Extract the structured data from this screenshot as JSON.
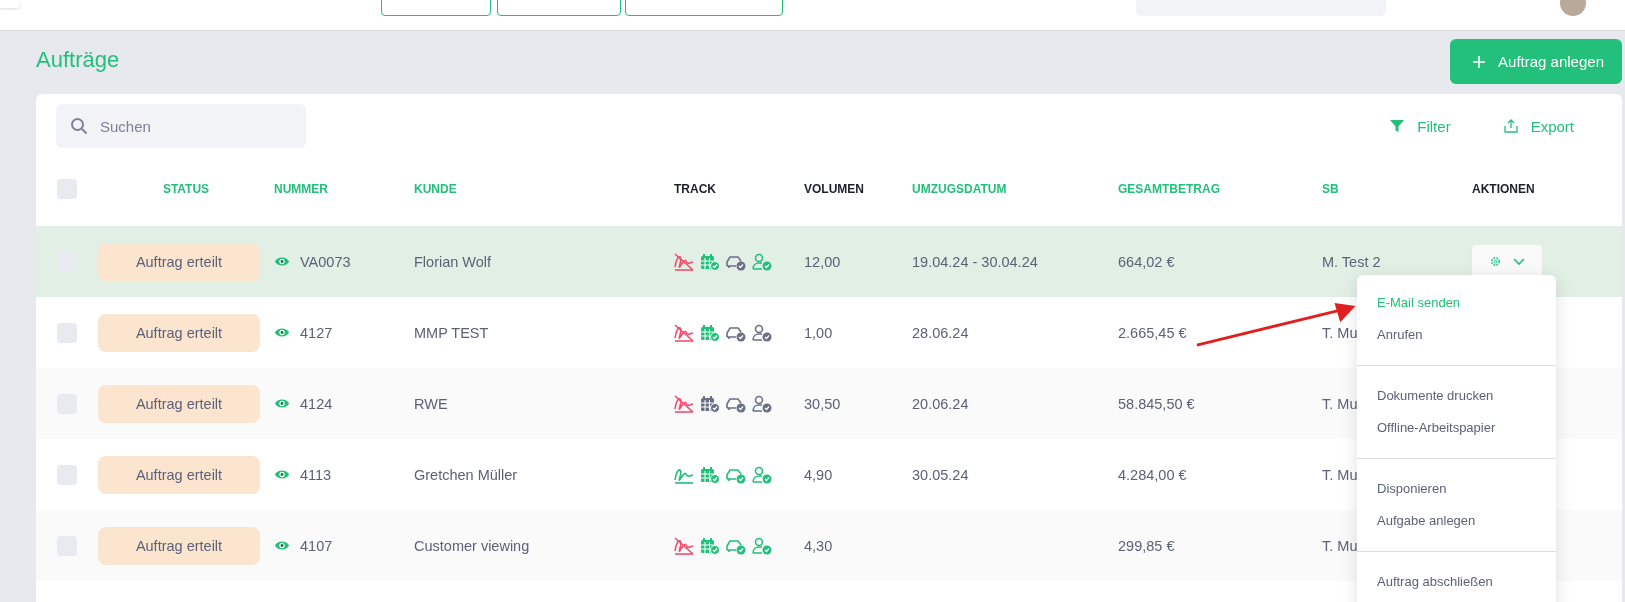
{
  "page_title": "Aufträge",
  "create_button": {
    "label": "Auftrag anlegen"
  },
  "search": {
    "placeholder": "Suchen"
  },
  "toolbar": [
    {
      "label": "Filter",
      "kind": "filter"
    },
    {
      "label": "Export",
      "kind": "export"
    }
  ],
  "table": {
    "select_all": {
      "checked": false
    },
    "columns": [
      {
        "label": "STATUS",
        "sortable": true
      },
      {
        "label": "NUMMER",
        "sortable": true
      },
      {
        "label": "KUNDE",
        "sortable": true
      },
      {
        "label": "TRACK",
        "sortable": false
      },
      {
        "label": "VOLUMEN",
        "sortable": false
      },
      {
        "label": "UMZUGSDATUM",
        "sortable": true
      },
      {
        "label": "GESAMTBETRAG",
        "sortable": true
      },
      {
        "label": "SB",
        "sortable": true
      },
      {
        "label": "AKTIONEN",
        "sortable": false
      }
    ],
    "rows": [
      {
        "selected": true,
        "checked": false,
        "status": "Auftrag erteilt",
        "number": "VA0073",
        "customer": "Florian Wolf",
        "track": [
          {
            "color": "#f0506e",
            "crossed": true
          },
          {
            "color": "#22c07a",
            "crossed": false
          },
          {
            "color": "#6b6f85",
            "crossed": false
          },
          {
            "color": "#22c07a",
            "crossed": false
          }
        ],
        "volume": "12,00",
        "date": "19.04.24 - 30.04.24",
        "total": "664,02 €",
        "sb": "M. Test 2"
      },
      {
        "selected": false,
        "checked": false,
        "status": "Auftrag erteilt",
        "number": "4127",
        "customer": "MMP TEST",
        "track": [
          {
            "color": "#f0506e",
            "crossed": true
          },
          {
            "color": "#22c07a",
            "crossed": false
          },
          {
            "color": "#6b6f85",
            "crossed": false
          },
          {
            "color": "#6b6f85",
            "crossed": false
          }
        ],
        "volume": "1,00",
        "date": "28.06.24",
        "total": "2.665,45 €",
        "sb": "T. Mu"
      },
      {
        "selected": false,
        "checked": false,
        "status": "Auftrag erteilt",
        "number": "4124",
        "customer": "RWE",
        "track": [
          {
            "color": "#f0506e",
            "crossed": true
          },
          {
            "color": "#6b6f85",
            "crossed": false
          },
          {
            "color": "#6b6f85",
            "crossed": false
          },
          {
            "color": "#6b6f85",
            "crossed": false
          }
        ],
        "volume": "30,50",
        "date": "20.06.24",
        "total": "58.845,50 €",
        "sb": "T. Mu"
      },
      {
        "selected": false,
        "checked": false,
        "status": "Auftrag erteilt",
        "number": "4113",
        "customer": "Gretchen Müller",
        "track": [
          {
            "color": "#22c07a",
            "crossed": false
          },
          {
            "color": "#22c07a",
            "crossed": false
          },
          {
            "color": "#22c07a",
            "crossed": false
          },
          {
            "color": "#22c07a",
            "crossed": false
          }
        ],
        "volume": "4,90",
        "date": "30.05.24",
        "total": "4.284,00 €",
        "sb": "T. Mu"
      },
      {
        "selected": false,
        "checked": false,
        "status": "Auftrag erteilt",
        "number": "4107",
        "customer": "Customer viewing",
        "track": [
          {
            "color": "#f0506e",
            "crossed": true
          },
          {
            "color": "#22c07a",
            "crossed": false
          },
          {
            "color": "#22c07a",
            "crossed": false
          },
          {
            "color": "#22c07a",
            "crossed": false
          }
        ],
        "volume": "4,30",
        "date": "",
        "total": "299,85 €",
        "sb": "T. Mu"
      }
    ]
  },
  "actions_menu": {
    "groups": [
      [
        {
          "label": "E-Mail senden",
          "highlighted": true
        },
        {
          "label": "Anrufen",
          "highlighted": false
        }
      ],
      [
        {
          "label": "Dokumente drucken",
          "highlighted": false
        },
        {
          "label": "Offline-Arbeitspapier",
          "highlighted": false
        }
      ],
      [
        {
          "label": "Disponieren",
          "highlighted": false
        },
        {
          "label": "Aufgabe anlegen",
          "highlighted": false
        }
      ],
      [
        {
          "label": "Auftrag abschließen",
          "highlighted": false
        }
      ]
    ]
  }
}
